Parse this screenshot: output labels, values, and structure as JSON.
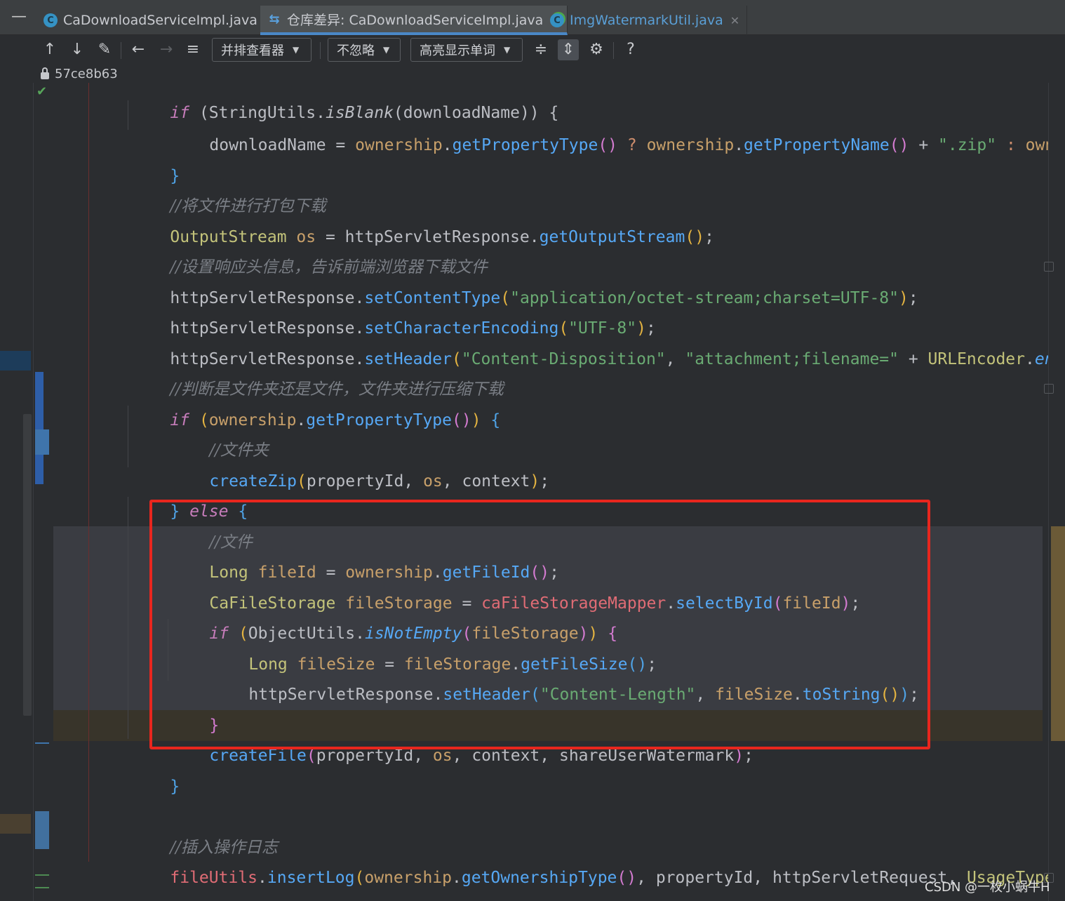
{
  "tabs": [
    {
      "label": "CaDownloadServiceImpl.java",
      "icon": "java-class-icon",
      "active": false
    },
    {
      "label": "仓库差异: CaDownloadServiceImpl.java",
      "icon": "diff-icon",
      "active": true
    },
    {
      "label": "ImgWatermarkUtil.java",
      "icon": "java-class-icon",
      "active": false
    }
  ],
  "toolbar": {
    "viewer_combo": "并排查看器",
    "ignore_combo": "不忽略",
    "highlight_combo": "高亮显示单词",
    "help": "?"
  },
  "revision": "57ce8b63",
  "code_lines": [
    "if (StringUtils.isBlank(downloadName)) {",
    "downloadName = ownership.getPropertyType() ? ownership.getPropertyName() + \".zip\" : owner",
    "}",
    "//将文件进行打包下载",
    "OutputStream os = httpServletResponse.getOutputStream();",
    "//设置响应头信息，告诉前端浏览器下载文件",
    "httpServletResponse.setContentType(\"application/octet-stream;charset=UTF-8\");",
    "httpServletResponse.setCharacterEncoding(\"UTF-8\");",
    "httpServletResponse.setHeader(\"Content-Disposition\", \"attachment;filename=\" + URLEncoder.enco",
    "//判断是文件夹还是文件，文件夹进行压缩下载",
    "if (ownership.getPropertyType()) {",
    "//文件夹",
    "createZip(propertyId, os, context);",
    "} else {",
    "//文件",
    "Long fileId = ownership.getFileId();",
    "CaFileStorage fileStorage = caFileStorageMapper.selectById(fileId);",
    "if (ObjectUtils.isNotEmpty(fileStorage)) {",
    "Long fileSize = fileStorage.getFileSize();",
    "httpServletResponse.setHeader(\"Content-Length\", fileSize.toString());",
    "}",
    "createFile(propertyId, os, context, shareUserWatermark);",
    "}",
    "",
    "//插入操作日志",
    "fileUtils.insertLog(ownership.getOwnershipType(), propertyId, httpServletRequest, UsageType.D",
    "}"
  ],
  "tokens": {
    "l1": [
      "if",
      " (",
      "StringUtils",
      ".",
      "isBlank",
      "(",
      "downloadName",
      ")) {"
    ],
    "l2": [
      "downloadName",
      " = ",
      "ownership",
      ".",
      "getPropertyType",
      "()",
      " ? ",
      "ownership",
      ".",
      "getPropertyName",
      "()",
      " + ",
      "\".zip\"",
      " : ",
      "owner"
    ],
    "l4": [
      "//将文件进行打包下载"
    ],
    "l5": [
      "OutputStream",
      " ",
      "os",
      " = ",
      "httpServletResponse",
      ".",
      "getOutputStream",
      "()",
      ";"
    ],
    "l6": [
      "//设置响应头信息，告诉前端浏览器下载文件"
    ],
    "l7": [
      "httpServletResponse",
      ".",
      "setContentType",
      "(",
      "\"application/octet-stream;charset=UTF-8\"",
      ")",
      ";"
    ],
    "l8": [
      "httpServletResponse",
      ".",
      "setCharacterEncoding",
      "(",
      "\"UTF-8\"",
      ")",
      ";"
    ],
    "l9": [
      "httpServletResponse",
      ".",
      "setHeader",
      "(",
      "\"Content-Disposition\"",
      ", ",
      "\"attachment;filename=\"",
      " + ",
      "URLEncoder",
      ".",
      "enco"
    ],
    "l10": [
      "//判断是文件夹还是文件，文件夹进行压缩下载"
    ],
    "l11": [
      "if",
      " (",
      "ownership",
      ".",
      "getPropertyType",
      "()",
      ")",
      " {"
    ],
    "l12": [
      "//文件夹"
    ],
    "l13": [
      "createZip",
      "(",
      "propertyId",
      ", ",
      "os",
      ", ",
      "context",
      ")",
      ";"
    ],
    "l14": [
      "}",
      " ",
      "else",
      " {"
    ],
    "l15": [
      "//文件"
    ],
    "l16": [
      "Long",
      " ",
      "fileId",
      " = ",
      "ownership",
      ".",
      "getFileId",
      "()",
      ";"
    ],
    "l17": [
      "CaFileStorage",
      " ",
      "fileStorage",
      " = ",
      "caFileStorageMapper",
      ".",
      "selectById",
      "(",
      "fileId",
      ")",
      ";"
    ],
    "l18": [
      "if",
      " (",
      "ObjectUtils",
      ".",
      "isNotEmpty",
      "(",
      "fileStorage",
      ")",
      ")",
      " {"
    ],
    "l19": [
      "Long",
      " ",
      "fileSize",
      " = ",
      "fileStorage",
      ".",
      "getFileSize",
      "()",
      ";"
    ],
    "l20": [
      "httpServletResponse",
      ".",
      "setHeader",
      "(",
      "\"Content-Length\"",
      ", ",
      "fileSize",
      ".",
      "toString",
      "()",
      ")",
      ";"
    ],
    "l21": [
      "}"
    ],
    "l22": [
      "createFile",
      "(",
      "propertyId",
      ", ",
      "os",
      ", ",
      "context",
      ", ",
      "shareUserWatermark",
      ")",
      ";"
    ],
    "l23": [
      "}"
    ],
    "l25": [
      "//插入操作日志"
    ],
    "l26": [
      "fileUtils",
      ".",
      "insertLog",
      "(",
      "ownership",
      ".",
      "getOwnershipType",
      "()",
      ", ",
      "propertyId",
      ", ",
      "httpServletRequest",
      ", ",
      "UsageType",
      ".",
      "D"
    ],
    "l27": [
      "}"
    ],
    "l3": [
      "}"
    ]
  },
  "watermark": "CSDN @一枚小蜗牛H",
  "colors": {
    "annotation": "#e8261e",
    "keyword": "#cf8e6d",
    "method": "#56a8f5",
    "string": "#6aab73",
    "comment": "#7a7e85"
  }
}
